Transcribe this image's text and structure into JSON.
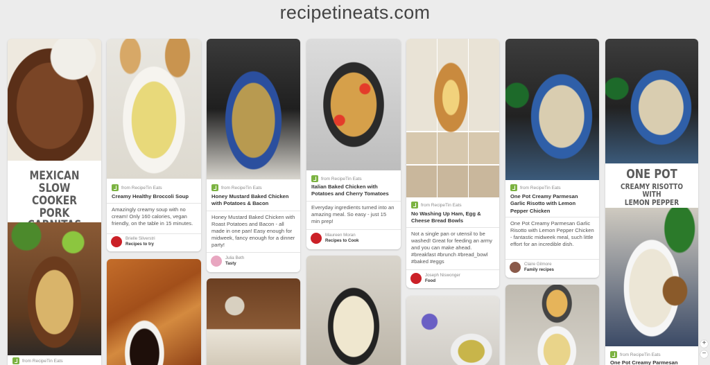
{
  "site": {
    "title": "recipetineats.com"
  },
  "pins": [
    {
      "id": "carnitas",
      "big_text": [
        "MEXICAN",
        "SLOW COOKER",
        "PORK CARNITAS"
      ],
      "source": "from RecipeTin Eats"
    },
    {
      "id": "broccoli",
      "source": "from RecipeTin Eats",
      "title": "Creamy Healthy Broccoli Soup",
      "description": "Amazingly creamy soup with no cream! Only 160 calories, vegan friendly, on the table in 15 minutes.",
      "pinner": {
        "name": "Brielle Silverstri",
        "board": "Recipes to try"
      }
    },
    {
      "id": "mustard",
      "source": "from RecipeTin Eats",
      "title": "Honey Mustard Baked Chicken with Potatoes & Bacon",
      "description": "Honey Mustard Baked Chicken with Roast Potatoes and Bacon - all made in one pan! Easy enough for midweek, fancy enough for a dinner party!",
      "pinner": {
        "name": "Julia Beth",
        "board": "Tasty"
      }
    },
    {
      "id": "italian",
      "source": "from RecipeTin Eats",
      "title": "Italian Baked Chicken with Potatoes and Cherry Tomatoes",
      "description": "Everyday ingredients turned into an amazing meal. So easy - just 15 min prep!",
      "pinner": {
        "name": "Maureen Moran",
        "board": "Recipes to Cook"
      }
    },
    {
      "id": "bread-bowls",
      "source": "from RecipeTin Eats",
      "title": "No Washing Up Ham, Egg & Cheese Bread Bowls",
      "description": "Not a single pan or utensil to be washed! Great for feeding an army and you can make ahead. #breakfast #brunch #bread_bowl #baked #eggs",
      "pinner": {
        "name": "Joseph Niswonger",
        "board": "Food"
      }
    },
    {
      "id": "risotto",
      "source": "from RecipeTin Eats",
      "title": "One Pot Creamy Parmesan Garlic Risotto with Lemon Pepper Chicken",
      "description": "One Pot Creamy Parmesan Garlic Risotto with Lemon Pepper Chicken - fantastic midweek meal, such little effort for an incredible dish.",
      "pinner": {
        "name": "Claire Gilmore",
        "board": "Family recipes"
      }
    },
    {
      "id": "risotto-2",
      "big_text": [
        "ONE POT",
        "CREAMY RISOTTO WITH",
        "LEMON PEPPER CHICKEN"
      ],
      "source": "from RecipeTin Eats",
      "title": "One Pot Creamy Parmesan"
    }
  ],
  "colors": {
    "background": "#ececec",
    "source_icon": "#7cb342",
    "pinterest_red": "#cb2027"
  }
}
